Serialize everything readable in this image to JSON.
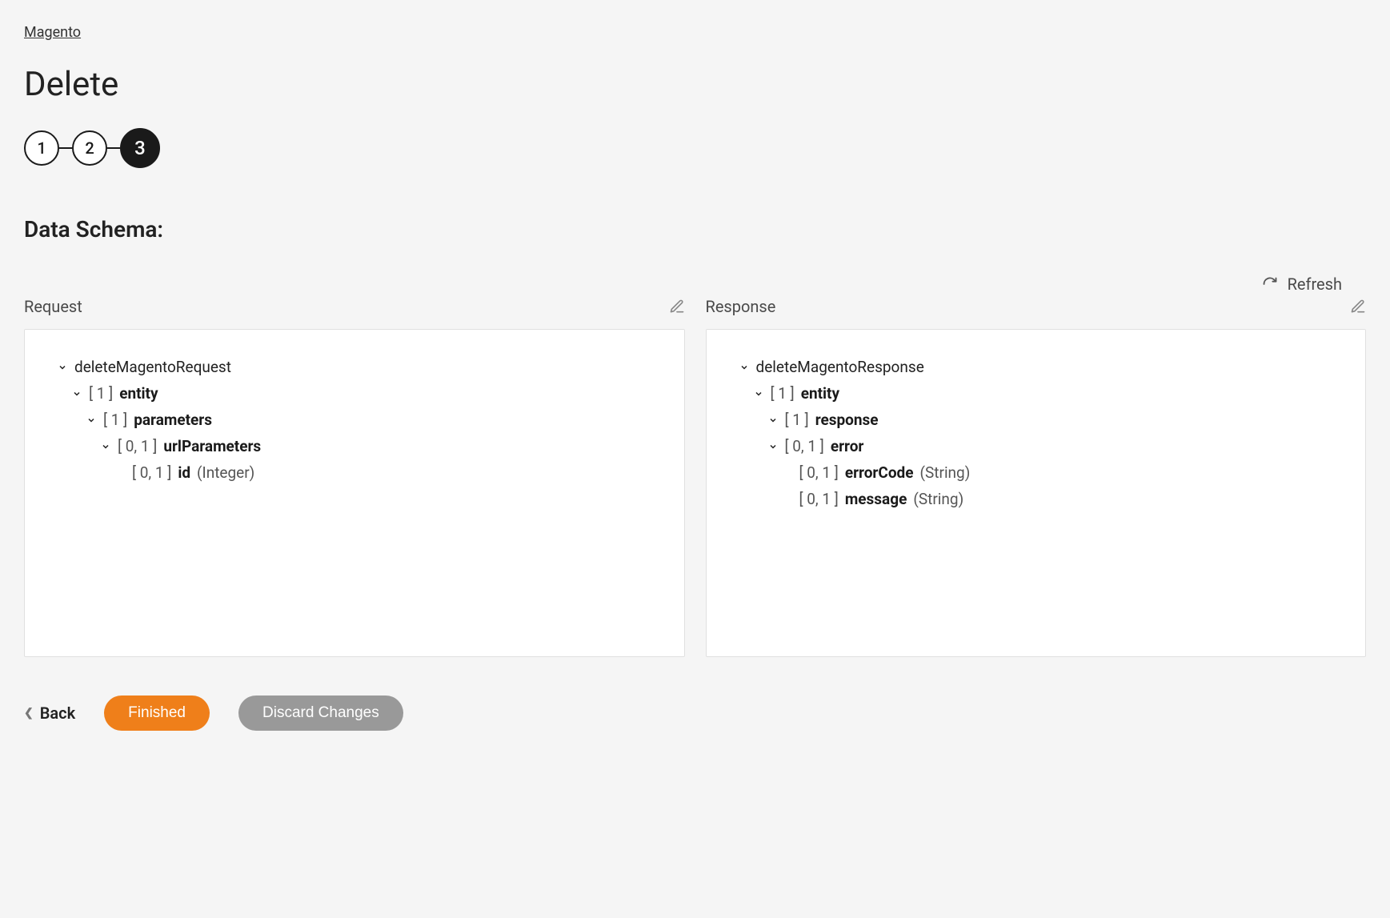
{
  "breadcrumb": "Magento",
  "title": "Delete",
  "steps": [
    "1",
    "2",
    "3"
  ],
  "activeStep": 2,
  "sectionTitle": "Data Schema:",
  "refreshLabel": "Refresh",
  "request": {
    "label": "Request",
    "root": "deleteMagentoRequest",
    "entity": {
      "card": "[ 1 ]",
      "name": "entity"
    },
    "parameters": {
      "card": "[ 1 ]",
      "name": "parameters"
    },
    "urlParameters": {
      "card": "[ 0, 1 ]",
      "name": "urlParameters"
    },
    "id": {
      "card": "[ 0, 1 ]",
      "name": "id",
      "type": "(Integer)"
    }
  },
  "response": {
    "label": "Response",
    "root": "deleteMagentoResponse",
    "entity": {
      "card": "[ 1 ]",
      "name": "entity"
    },
    "resp": {
      "card": "[ 1 ]",
      "name": "response"
    },
    "error": {
      "card": "[ 0, 1 ]",
      "name": "error"
    },
    "errorCode": {
      "card": "[ 0, 1 ]",
      "name": "errorCode",
      "type": "(String)"
    },
    "message": {
      "card": "[ 0, 1 ]",
      "name": "message",
      "type": "(String)"
    }
  },
  "footer": {
    "back": "Back",
    "finished": "Finished",
    "discard": "Discard Changes"
  }
}
